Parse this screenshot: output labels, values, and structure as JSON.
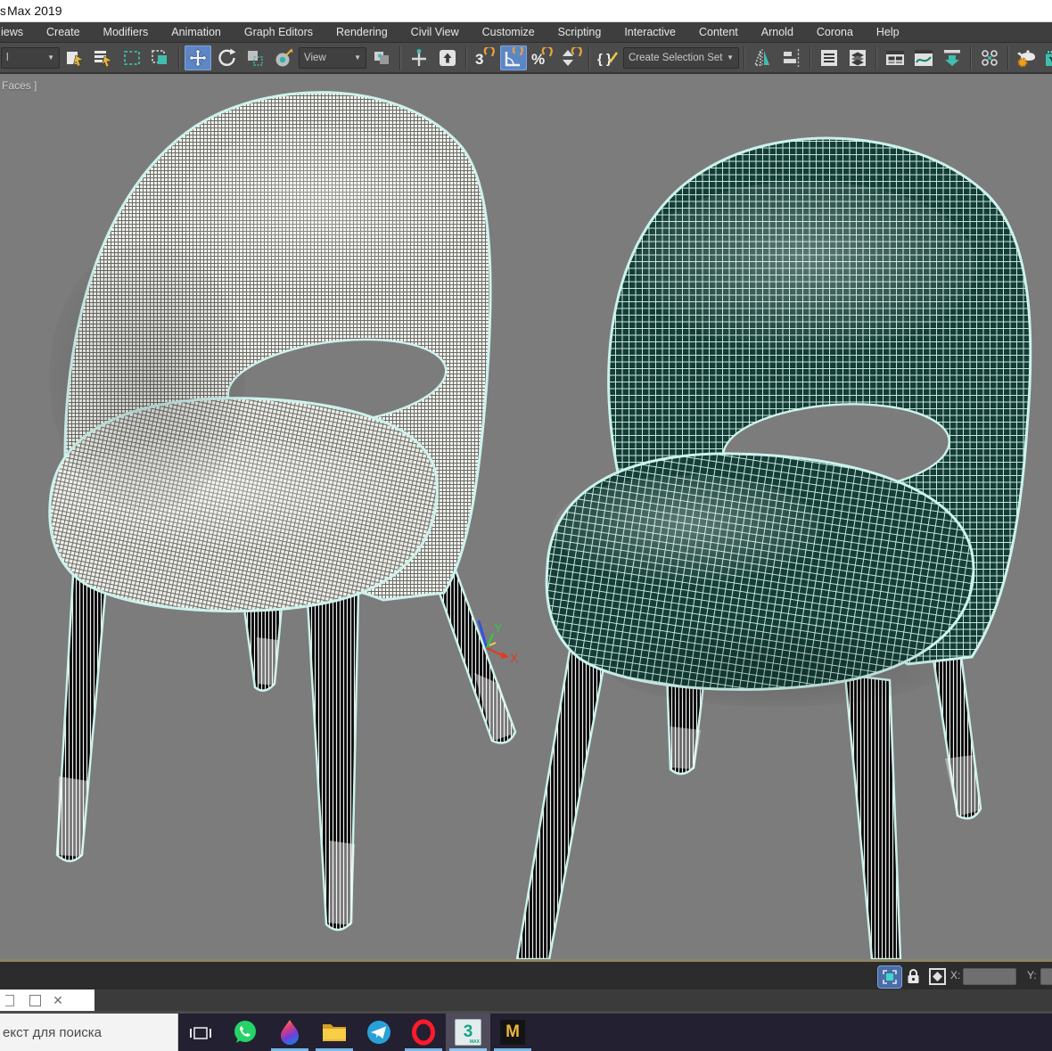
{
  "titlebar": {
    "title": "Max 2019",
    "clipped_prefix": "s"
  },
  "menubar": {
    "items": [
      "iews",
      "Create",
      "Modifiers",
      "Animation",
      "Graph Editors",
      "Rendering",
      "Civil View",
      "Customize",
      "Scripting",
      "Interactive",
      "Content",
      "Arnold",
      "Corona",
      "Help"
    ]
  },
  "toolbar": {
    "filter_dropdown_text": "l",
    "view_dropdown_label": "View",
    "selection_set_label": "Create Selection Set",
    "dropdown_arrow": "▼",
    "snap_3d_glyph": "3",
    "percent_glyph": "%",
    "sets_glyph": "{ }",
    "icon_names": [
      "select-object-icon",
      "select-by-name-icon",
      "rect-region-icon",
      "crossing-selection-icon",
      "move-icon",
      "rotate-icon",
      "scale-icon",
      "select-place-icon",
      "pivot-center-icon",
      "manipulate-icon",
      "keyboard-override-icon",
      "snap-3d-icon",
      "angle-snap-icon",
      "percent-snap-icon",
      "spinner-snap-icon",
      "edit-selection-sets-icon",
      "mirror-icon",
      "align-icon",
      "scene-explorer-icon",
      "layer-explorer-icon",
      "ribbon-icon",
      "curve-editor-icon",
      "schematic-view-icon",
      "material-editor-icon",
      "render-setup-icon",
      "rendered-frame-icon",
      "render-production-icon"
    ]
  },
  "viewport": {
    "stats_label": "Faces ]",
    "gizmo": {
      "x": "X",
      "y": "Y"
    }
  },
  "statusbar": {
    "x_label": "X:",
    "y_label": "Y:",
    "x_value": "",
    "y_value": ""
  },
  "overlay_window": {
    "close_glyph": "✕"
  },
  "taskbar": {
    "search_text": "екст для поиска",
    "max_glyph": "3",
    "max_sub": "MAX",
    "m_glyph": "M",
    "icons": [
      "task-view-icon",
      "whatsapp-icon",
      "paint-3d-icon",
      "file-explorer-icon",
      "telegram-icon",
      "opera-icon",
      "3ds-max-icon",
      "m-letter-icon"
    ]
  },
  "colors": {
    "viewport_bg": "#7c7c7c",
    "selection_outline": "#cdf2ec",
    "chair_white_mesh_bg": "#f0f1eb",
    "chair_white_mesh_line": "#4a4a46",
    "chair_teal_dark": "#133d36",
    "chair_teal_line": "#c8e6dc",
    "leg_dark": "#060606",
    "leg_stripe": "#efefef",
    "active_tool_blue": "#5d86c4",
    "snap_orange": "#e8a33d",
    "taskbar_underline": "#7ab8e8",
    "viewport_border_tan": "#8d8363"
  }
}
